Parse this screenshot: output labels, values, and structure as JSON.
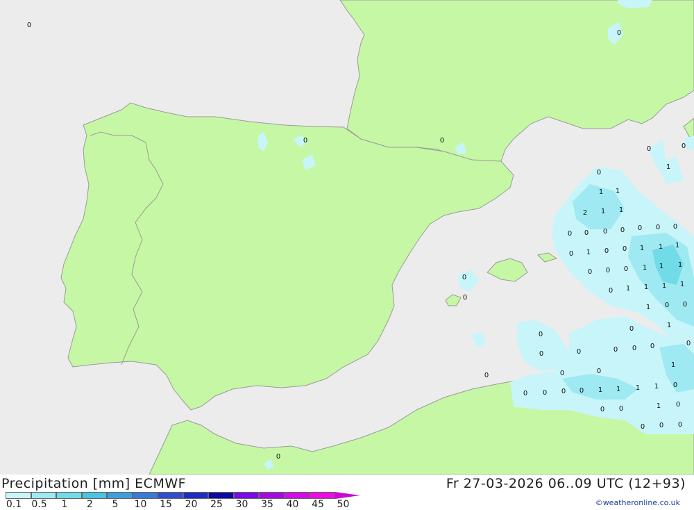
{
  "map": {
    "colors": {
      "sea": "#ececec",
      "land": "#c6f7a4",
      "border": "#9a9a9a",
      "precip_0_1": "#c8f5fa",
      "precip_0_5": "#9ee9f2",
      "precip_1": "#72dbe8"
    },
    "labels": {
      "a": "0",
      "b": "0",
      "c": "0",
      "d": "0",
      "e": "0",
      "f": "0",
      "g": "1",
      "h": "0",
      "i": "1",
      "j": "1",
      "k": "2",
      "l": "1",
      "m": "1",
      "n": "0",
      "o": "0",
      "p": "0",
      "q": "0",
      "r": "0",
      "s": "0",
      "t": "0",
      "u": "1",
      "v": "0",
      "w": "0",
      "x": "1",
      "y": "1",
      "z": "1",
      "aa": "0",
      "ab": "0",
      "ac": "0",
      "ad": "1",
      "ae": "1",
      "af": "1",
      "ag": "0",
      "ah": "1",
      "ai": "1",
      "aj": "1",
      "ak": "1",
      "al": "0",
      "am": "0",
      "an": "0",
      "ao": "0",
      "ap": "1",
      "aq": "0",
      "ar": "0",
      "as": "0",
      "at": "0",
      "au": "0",
      "av": "0",
      "aw": "0",
      "ax": "0",
      "ay": "0",
      "az": "1",
      "ba": "1",
      "bb": "0",
      "bc": "0",
      "bd": "0",
      "be": "0",
      "bf": "0",
      "bg": "0",
      "bh": "1",
      "bi": "1",
      "bj": "1",
      "bk": "1",
      "bl": "0",
      "bm": "0",
      "bn": "0",
      "bo": "1",
      "bp": "0",
      "bq": "0",
      "br": "0",
      "bs": "0",
      "bt": "0",
      "bu": "0"
    }
  },
  "footer": {
    "title": "Precipitation [mm] ECMWF",
    "datetime": "Fr 27-03-2026 06..09 UTC (12+93)",
    "credit": "©weatheronline.co.uk",
    "legend": {
      "colors": [
        "#c8f5fa",
        "#9ee9f2",
        "#72dbe8",
        "#49c4e0",
        "#3da0dc",
        "#3a79d8",
        "#2f4fd0",
        "#1e2ec0",
        "#0c0aa0",
        "#7a0ae8",
        "#a60ae0",
        "#d40ae8",
        "#f00ae8",
        "#c80ad0"
      ],
      "ticks": [
        "0.1",
        "0.5",
        "1",
        "2",
        "5",
        "10",
        "15",
        "20",
        "25",
        "30",
        "35",
        "40",
        "45",
        "50"
      ]
    }
  }
}
